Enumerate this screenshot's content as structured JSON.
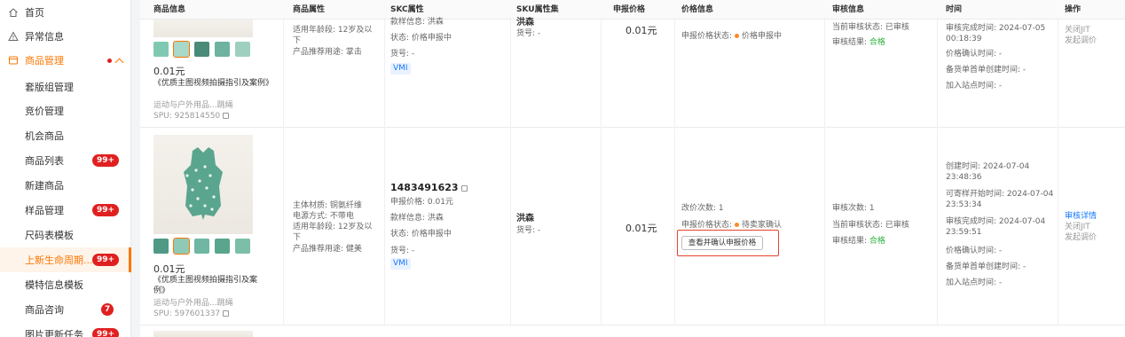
{
  "sidebar": {
    "items": [
      {
        "label": "首页"
      },
      {
        "label": "异常信息"
      },
      {
        "label": "商品管理"
      },
      {
        "label": "套版组管理"
      },
      {
        "label": "竞价管理"
      },
      {
        "label": "机会商品"
      },
      {
        "label": "商品列表",
        "badge": "99+"
      },
      {
        "label": "新建商品"
      },
      {
        "label": "样品管理",
        "badge": "99+"
      },
      {
        "label": "尺码表模板"
      },
      {
        "label": "上新生命周期...",
        "badge": "99+"
      },
      {
        "label": "模特信息模板"
      },
      {
        "label": "商品咨询",
        "badge": "7"
      },
      {
        "label": "图片更新任务",
        "badge": "99+"
      }
    ]
  },
  "table": {
    "headers": [
      "商品信息",
      "商品属性",
      "SKC属性",
      "SKU属性集",
      "申报价格",
      "价格信息",
      "审核信息",
      "时间",
      "操作"
    ],
    "row1": {
      "price_text": "0.01元",
      "title": "《优质主图视频拍摄指引及案例》",
      "category": "运动与户外用品...跳绳",
      "spu": "SPU: 925814550",
      "attrs": [
        "适用年龄段: 12岁及以下",
        "产品推荐用途: 掌击"
      ],
      "skc_top": "款样信息: 洪森",
      "skc_status": "状态: 价格申报中",
      "skc_no": "货号: -",
      "vmi": "VMI",
      "sku_name": "洪森",
      "sku_no": "货号: -",
      "declared_price": "0.01元",
      "price_state_label": "申报价格状态:",
      "price_state": "价格申报中",
      "audit_state": "当前审核状态: 已审核",
      "audit_result_label": "审核结果:",
      "audit_result": "合格",
      "time_done": "审核完成时间: 2024-07-05 00:18:39",
      "time_price_confirm": "价格确认时间: -",
      "time_stock": "备货单首单创建时间: -",
      "time_join": "加入站点时间: -",
      "ops": [
        "关闭JIT",
        "发起调价"
      ]
    },
    "row2": {
      "price_text": "0.01元",
      "title": "《优质主图视频拍摄指引及案例》",
      "category": "运动与户外用品...跳绳",
      "spu": "SPU: 597601337",
      "attrs": [
        "主体材质: 铜氨纤维",
        "电源方式: 不带电",
        "适用年龄段: 12岁及以下",
        "产品推荐用途: 健美"
      ],
      "skc_id": "1483491623",
      "skc_declared": "申报价格: 0.01元",
      "skc_sample": "款样信息: 洪森",
      "skc_status": "状态: 价格申报中",
      "skc_no": "货号: -",
      "vmi": "VMI",
      "sku_name": "洪森",
      "sku_no": "货号: -",
      "declared_price": "0.01元",
      "adjust_count": "改价次数: 1",
      "price_state_label": "申报价格状态:",
      "price_state": "待卖家确认",
      "confirm_button": "查看并确认申报价格",
      "audit_count": "审核次数: 1",
      "audit_state": "当前审核状态: 已审核",
      "audit_result_label": "审核结果:",
      "audit_result": "合格",
      "time_created": "创建时间: 2024-07-04 23:48:36",
      "time_sample_start": "可寄样开始时间: 2024-07-04 23:53:34",
      "time_done": "审核完成时间: 2024-07-04 23:59:51",
      "time_price_confirm": "价格确认时间: -",
      "time_stock": "备货单首单创建时间: -",
      "time_join": "加入站点时间: -",
      "ops": [
        "审核详情",
        "关闭JIT",
        "发起调价"
      ]
    }
  },
  "colors": {
    "accent": "#fb7701",
    "badge": "#e02020",
    "link": "#1677ff",
    "ok": "#2ab33c",
    "highlight": "#e5442c"
  }
}
